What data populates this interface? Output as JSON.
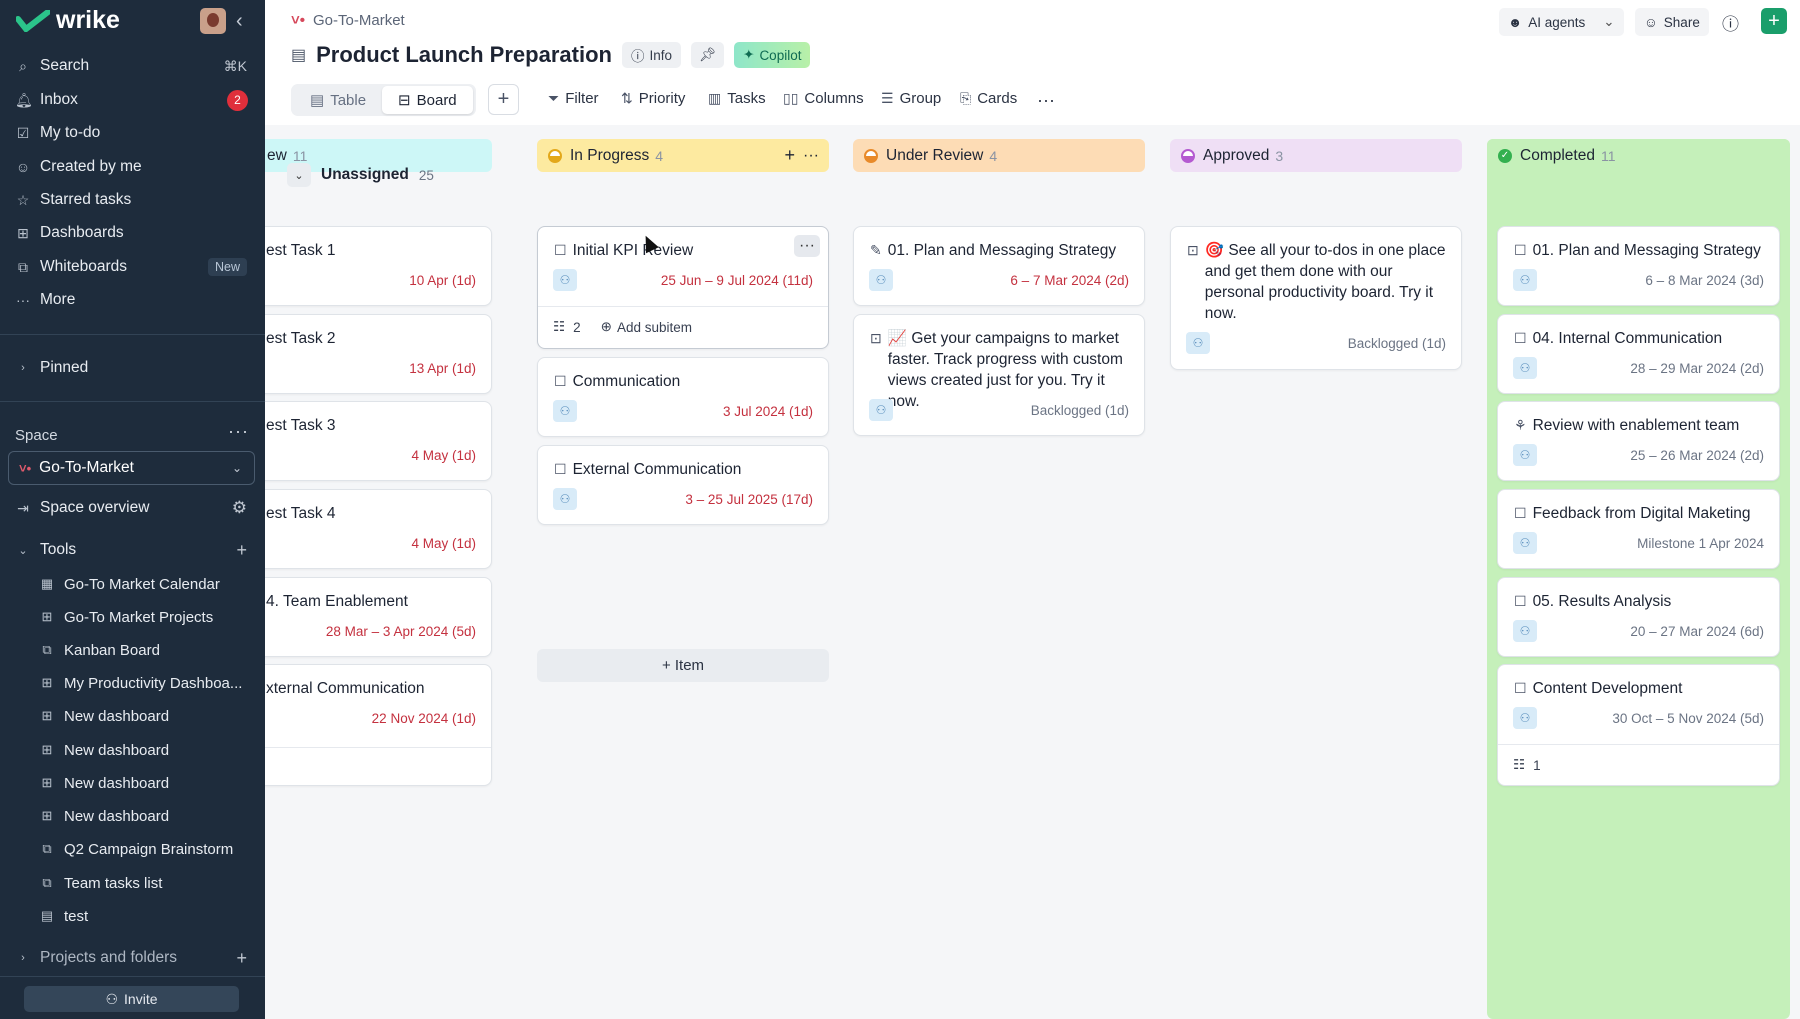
{
  "brand": {
    "name": "wrike",
    "accent": "#1a9e6b"
  },
  "sidebar": {
    "nav": [
      {
        "label": "Search",
        "icon": "search-icon",
        "shortcut": "⌘K"
      },
      {
        "label": "Inbox",
        "icon": "bell-icon",
        "badge": "2"
      },
      {
        "label": "My to-do",
        "icon": "user-check-icon"
      },
      {
        "label": "Created by me",
        "icon": "user-icon"
      },
      {
        "label": "Starred tasks",
        "icon": "star-icon"
      },
      {
        "label": "Dashboards",
        "icon": "dashboard-icon"
      },
      {
        "label": "Whiteboards",
        "icon": "whiteboard-icon",
        "tag": "New"
      },
      {
        "label": "More",
        "icon": "dots-icon"
      }
    ],
    "pinned": "Pinned",
    "space_label": "Space",
    "space_name": "Go-To-Market",
    "space_overview": "Space overview",
    "tools_label": "Tools",
    "tools": [
      {
        "label": "Go-To Market Calendar",
        "icon": "calendar-icon"
      },
      {
        "label": "Go-To Market Projects",
        "icon": "table-icon"
      },
      {
        "label": "Kanban Board",
        "icon": "board-icon"
      },
      {
        "label": "My Productivity Dashboa...",
        "icon": "table-icon"
      },
      {
        "label": "New dashboard",
        "icon": "table-icon"
      },
      {
        "label": "New dashboard",
        "icon": "table-icon"
      },
      {
        "label": "New dashboard",
        "icon": "table-icon"
      },
      {
        "label": "New dashboard",
        "icon": "table-icon"
      },
      {
        "label": "Q2 Campaign Brainstorm",
        "icon": "board-icon"
      },
      {
        "label": "Team tasks list",
        "icon": "board-icon"
      },
      {
        "label": "test",
        "icon": "doc-icon"
      }
    ],
    "projects_label": "Projects and folders",
    "invite_label": "Invite"
  },
  "header": {
    "breadcrumb": "Go-To-Market",
    "title": "Product Launch Preparation",
    "info_label": "Info",
    "copilot_label": "Copilot",
    "views": [
      "Table",
      "Board"
    ],
    "toolbar": [
      "Filter",
      "Priority",
      "Tasks",
      "Columns",
      "Group",
      "Cards"
    ],
    "ai_agents_label": "AI agents",
    "share_label": "Share"
  },
  "board": {
    "columns": [
      {
        "name": "New",
        "visible_name": "ew",
        "count": "11",
        "color": "#cdf7f7",
        "status": "#16a3a3"
      },
      {
        "name": "In Progress",
        "count": "4",
        "color": "#fdeaa0",
        "status": "#e3a81b"
      },
      {
        "name": "Under Review",
        "count": "4",
        "color": "#fddcb5",
        "status": "#e88a2a"
      },
      {
        "name": "Approved",
        "count": "3",
        "color": "#efdff5",
        "status": "#b45ad1"
      },
      {
        "name": "Completed",
        "count": "11",
        "color": "#c5f0ba",
        "status": "#33b04f"
      }
    ],
    "group": {
      "name": "Unassigned",
      "count": "25"
    },
    "new_cards": [
      {
        "title": "est Task 1",
        "date": "10 Apr (1d)"
      },
      {
        "title": "est Task 2",
        "date": "13 Apr (1d)"
      },
      {
        "title": "est Task 3",
        "date": "4 May (1d)"
      },
      {
        "title": "est Task 4",
        "date": "4 May (1d)"
      },
      {
        "title": "4. Team Enablement",
        "date": "28 Mar – 3 Apr 2024 (5d)"
      },
      {
        "title": "xternal Communication",
        "date": "22 Nov 2024 (1d)"
      }
    ],
    "inprogress_cards": [
      {
        "title": "Initial KPI Review",
        "date": "25 Jun – 9 Jul 2024 (11d)",
        "subitems": "2",
        "add_subitem": "Add subitem"
      },
      {
        "title": "Communication",
        "date": "3 Jul 2024 (1d)"
      },
      {
        "title": "External Communication",
        "date": "3 – 25 Jul 2025 (17d)"
      }
    ],
    "add_item_label": "+ Item",
    "review_cards": [
      {
        "title": "01. Plan and Messaging Strategy",
        "date": "6 – 7 Mar 2024 (2d)"
      },
      {
        "title": "📈 Get your campaigns to market faster. Track progress with custom views created just for you. Try it now.",
        "date": "Backlogged (1d)"
      }
    ],
    "approved_cards": [
      {
        "title": "🎯 See all your to-dos in one place and get them done with our personal productivity board. Try it now.",
        "date": "Backlogged (1d)"
      }
    ],
    "completed_cards": [
      {
        "title": "01. Plan and Messaging Strategy",
        "date": "6 – 8 Mar 2024 (3d)"
      },
      {
        "title": "04. Internal Communication",
        "date": "28 – 29 Mar 2024 (2d)"
      },
      {
        "title": "Review with enablement team",
        "date": "25 – 26 Mar 2024 (2d)"
      },
      {
        "title": "Feedback from Digital Maketing",
        "date": "Milestone 1 Apr 2024"
      },
      {
        "title": "05. Results Analysis",
        "date": "20 – 27 Mar 2024 (6d)"
      },
      {
        "title": "Content Development",
        "date": "30 Oct – 5 Nov 2024 (5d)",
        "subitems": "1"
      }
    ]
  }
}
